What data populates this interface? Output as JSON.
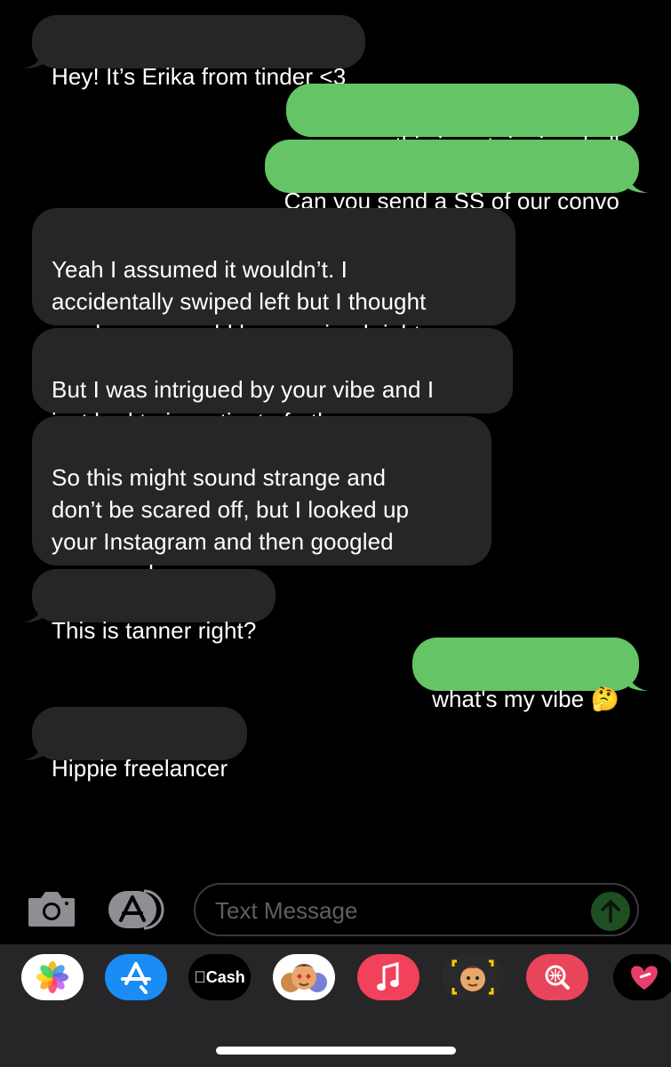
{
  "messages": [
    {
      "from": "them",
      "text": "Hey! It’s Erika from tinder <3"
    },
    {
      "from": "me",
      "text": "so sorry this is not ringin a bell"
    },
    {
      "from": "me",
      "text": "Can you send a SS of our convo"
    },
    {
      "from": "them",
      "text": "Yeah I assumed it wouldn’t. I\naccidentally swiped left but I thought\nmaybe you would have swiped right"
    },
    {
      "from": "them",
      "text": "But I was intrigued by your vibe and I\njust had to investigate further"
    },
    {
      "from": "them",
      "text": "So this might sound strange and\ndon’t be scared off, but I looked up\nyour Instagram and then googled\nyour number"
    },
    {
      "from": "them",
      "text": "This is tanner right?"
    },
    {
      "from": "me",
      "text": "what's my vibe 🤔"
    },
    {
      "from": "them",
      "text": "Hippie freelancer"
    }
  ],
  "composer": {
    "placeholder": "Text Message"
  },
  "app_drawer": {
    "cash_label": "Cash"
  },
  "colors": {
    "incoming_bubble": "#262628",
    "outgoing_bubble": "#65c466",
    "drawer": "#262628"
  },
  "icons": [
    "camera-icon",
    "app-store-icon",
    "send-arrow-icon",
    "photos-icon",
    "apple-cash-icon",
    "memoji-stickers-icon",
    "music-icon",
    "memoji-icon",
    "search-images-icon",
    "heart-stickers-icon"
  ]
}
